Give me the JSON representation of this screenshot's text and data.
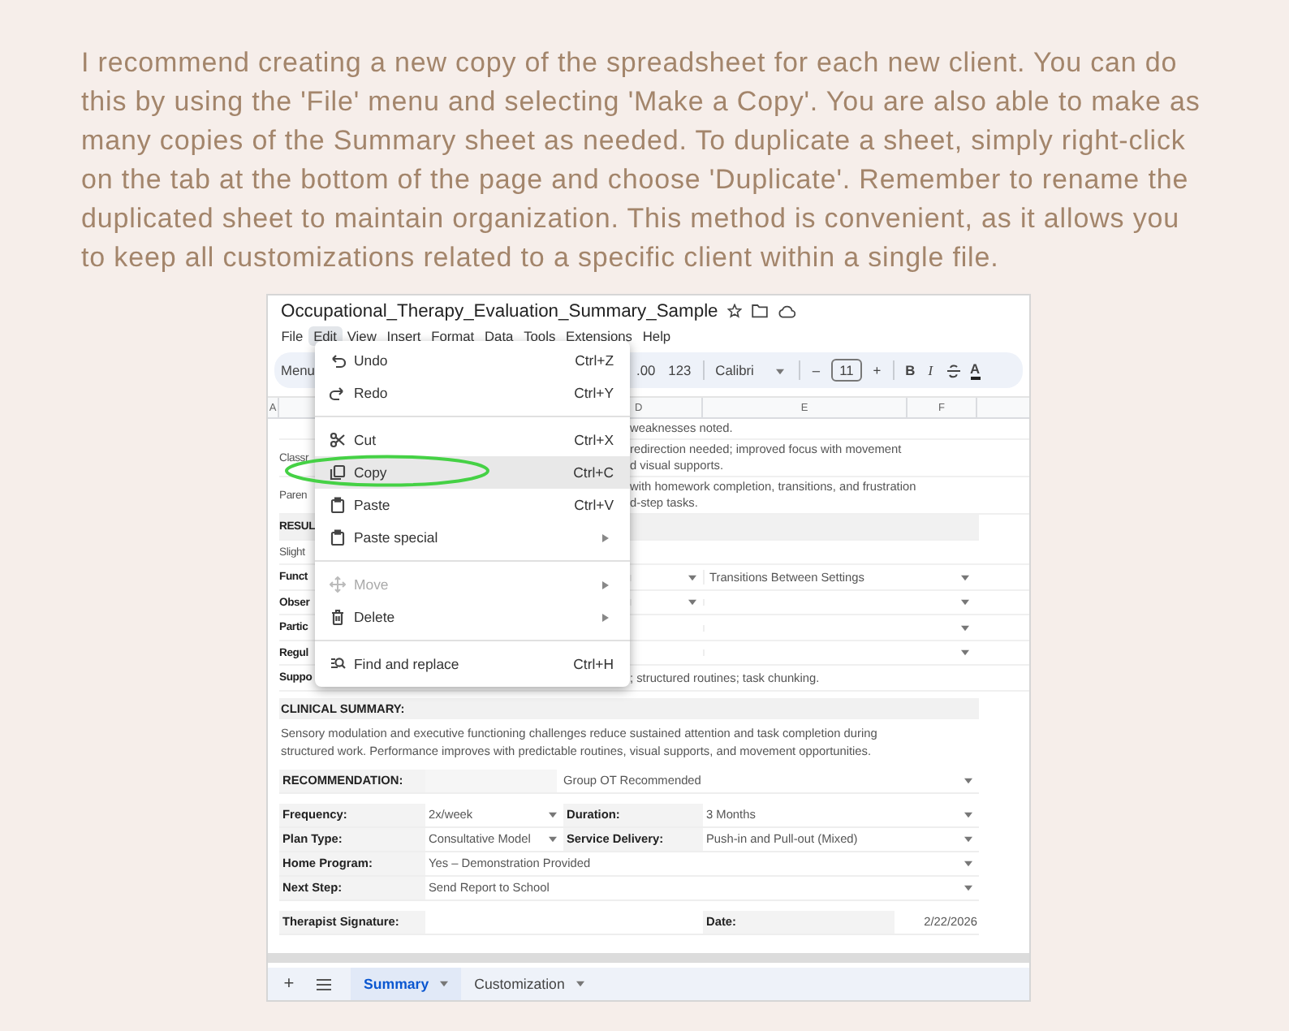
{
  "intro": "I recommend creating a new copy of the spreadsheet for each new client. You can do this by using the 'File' menu and selecting 'Make a Copy'. You are also able to make as many copies of the Summary sheet as needed. To duplicate a sheet, simply right-click on the tab at the bottom of the page and choose 'Duplicate'. Remember to rename the duplicated sheet to maintain organization. This method is convenient, as it allows you to keep all customizations related to a specific client within a single file.",
  "sheet": {
    "title": "Occupational_Therapy_Evaluation_Summary_Sample",
    "menubar": [
      {
        "label": "File",
        "selected": false
      },
      {
        "label": "Edit",
        "selected": true
      },
      {
        "label": "View",
        "selected": false
      },
      {
        "label": "Insert",
        "selected": false
      },
      {
        "label": "Format",
        "selected": false
      },
      {
        "label": "Data",
        "selected": false
      },
      {
        "label": "Tools",
        "selected": false
      },
      {
        "label": "Extensions",
        "selected": false
      },
      {
        "label": "Help",
        "selected": false
      }
    ],
    "toolbar": {
      "menus": "Menu",
      "decimal": ".00",
      "number_format": "123",
      "font": "Calibri",
      "decrease": "–",
      "font_size": "11",
      "increase": "+",
      "bold": "B",
      "italic": "I",
      "text_color": "A"
    },
    "columns": [
      "A",
      "D",
      "E",
      "F"
    ],
    "upper_rows": [
      {
        "lines": [
          "weaknesses noted."
        ],
        "shaded": false
      },
      {
        "label": "Classr",
        "lines": [
          "redirection needed; improved focus with movement",
          "d visual supports."
        ],
        "bold": false,
        "shaded": false
      },
      {
        "label": "Paren",
        "lines": [
          "with homework completion, transitions, and frustration",
          "d-step tasks."
        ],
        "bold": false,
        "shaded": false
      },
      {
        "label": "RESUL",
        "bold": true,
        "shaded": true
      },
      {
        "label": "Slight",
        "bold": false,
        "shaded": false
      },
      {
        "label": "Funct",
        "value": "Transitions Between Settings",
        "bold": true,
        "shaded": false,
        "mid_dropdown": true,
        "dropdown": true
      },
      {
        "label": "Obser",
        "bold": true,
        "shaded": false,
        "mid_dropdown": true,
        "dropdown": true
      },
      {
        "label": "Partic",
        "bold": true,
        "shaded": false,
        "dropdown": true
      },
      {
        "label": "Regul",
        "bold": true,
        "shaded": false,
        "dropdown": true
      },
      {
        "label": "Suppo",
        "lines": [
          "; structured routines; task chunking."
        ],
        "bold": true,
        "shaded": false
      }
    ],
    "summary": {
      "heading": "CLINICAL SUMMARY:",
      "lines": [
        "Sensory modulation and executive functioning challenges reduce sustained attention and task completion during",
        "structured work. Performance improves with predictable routines, visual supports, and movement opportunities."
      ]
    },
    "recommendation": {
      "label": "RECOMMENDATION:",
      "value": "Group OT Recommended",
      "dropdown": true
    },
    "plan_rows": [
      {
        "label": "Frequency:",
        "value": "2x/week",
        "dropdown": true,
        "label2": "Duration:",
        "value2": "3 Months",
        "dropdown2": true
      },
      {
        "label": "Plan Type:",
        "value": "Consultative Model",
        "dropdown": true,
        "label2": "Service Delivery:",
        "value2": "Push-in and Pull-out (Mixed)",
        "dropdown2": true
      },
      {
        "label": "Home Program:",
        "value": "Yes – Demonstration Provided",
        "dropdown": true
      },
      {
        "label": "Next Step:",
        "value": "Send Report to School",
        "dropdown": true
      }
    ],
    "signature": {
      "label": "Therapist Signature:",
      "date_label": "Date:",
      "date": "2/22/2026"
    },
    "add_sheet": "+",
    "sheet_tabs": [
      {
        "label": "Summary",
        "selected": true
      },
      {
        "label": "Customization",
        "selected": false
      }
    ],
    "edit_menu": [
      {
        "kind": "item",
        "label": "Undo",
        "shortcut": "Ctrl+Z",
        "selected": false,
        "disabled": false,
        "submenu": false,
        "annotated": false
      },
      {
        "kind": "item",
        "label": "Redo",
        "shortcut": "Ctrl+Y",
        "selected": false,
        "disabled": false,
        "submenu": false,
        "annotated": false
      },
      {
        "kind": "separator"
      },
      {
        "kind": "item",
        "label": "Cut",
        "shortcut": "Ctrl+X",
        "selected": false,
        "disabled": false,
        "submenu": false,
        "annotated": false
      },
      {
        "kind": "item",
        "label": "Copy",
        "shortcut": "Ctrl+C",
        "selected": true,
        "disabled": false,
        "submenu": false,
        "annotated": true
      },
      {
        "kind": "item",
        "label": "Paste",
        "shortcut": "Ctrl+V",
        "selected": false,
        "disabled": false,
        "submenu": false,
        "annotated": false
      },
      {
        "kind": "item",
        "label": "Paste special",
        "selected": false,
        "disabled": false,
        "submenu": true,
        "annotated": false
      },
      {
        "kind": "separator"
      },
      {
        "kind": "item",
        "label": "Move",
        "selected": false,
        "disabled": true,
        "submenu": true,
        "annotated": false
      },
      {
        "kind": "item",
        "label": "Delete",
        "selected": false,
        "disabled": false,
        "submenu": true,
        "annotated": false
      },
      {
        "kind": "separator"
      },
      {
        "kind": "item",
        "label": "Find and replace",
        "shortcut": "Ctrl+H",
        "selected": false,
        "disabled": false,
        "submenu": false,
        "annotated": false
      }
    ]
  }
}
